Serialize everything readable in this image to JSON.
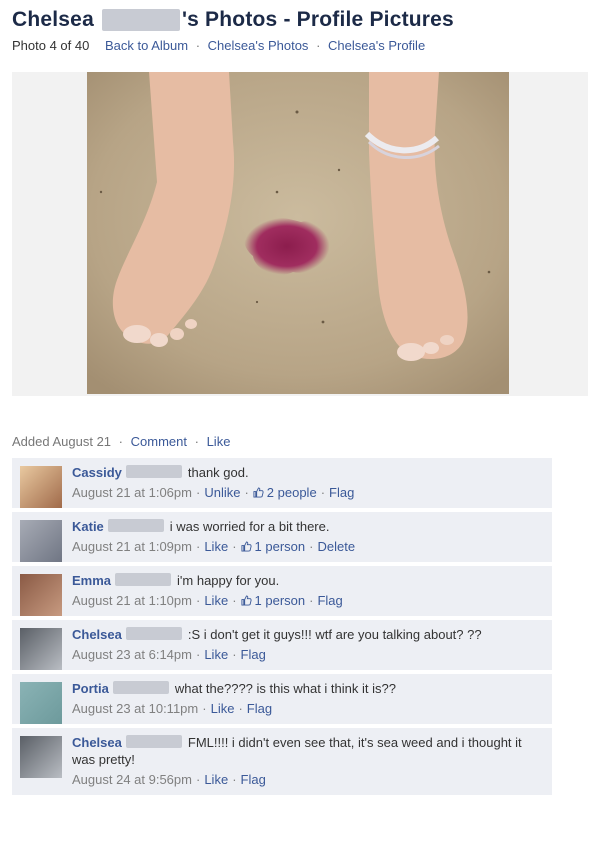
{
  "header": {
    "title_name": "Chelsea",
    "title_rest": "'s Photos - Profile Pictures",
    "photo_count": "Photo 4 of 40",
    "links": [
      "Back to Album",
      "Chelsea's Photos",
      "Chelsea's Profile"
    ],
    "separator": "·"
  },
  "photo_meta": {
    "added": "Added August 21",
    "comment_link": "Comment",
    "like_link": "Like"
  },
  "comments": [
    {
      "author": "Cassidy",
      "text": "thank god.",
      "time": "August 21 at 1:06pm",
      "actions": [
        "Unlike"
      ],
      "likes": "2 people",
      "trail": "Flag",
      "avatar_colors": [
        "#e9c9a0",
        "#a06a4a"
      ]
    },
    {
      "author": "Katie",
      "text": "i was worried for a bit there.",
      "time": "August 21 at 1:09pm",
      "actions": [
        "Like"
      ],
      "likes": "1 person",
      "trail": "Delete",
      "avatar_colors": [
        "#a7abb5",
        "#707684"
      ]
    },
    {
      "author": "Emma",
      "text": "i'm happy for you.",
      "time": "August 21 at 1:10pm",
      "actions": [
        "Like"
      ],
      "likes": "1 person",
      "trail": "Flag",
      "avatar_colors": [
        "#8a5a45",
        "#c79a80"
      ]
    },
    {
      "author": "Chelsea",
      "text": ":S i don't get it guys!!! wtf are you talking about? ??",
      "time": "August 23 at 6:14pm",
      "actions": [
        "Like"
      ],
      "likes": "",
      "trail": "Flag",
      "avatar_colors": [
        "#5a5f66",
        "#b9bdc3"
      ]
    },
    {
      "author": "Portia",
      "text": "what the???? is this what i think it is??",
      "time": "August 23 at 10:11pm",
      "actions": [
        "Like"
      ],
      "likes": "",
      "trail": "Flag",
      "avatar_colors": [
        "#8ab3b5",
        "#6d9a9c"
      ]
    },
    {
      "author": "Chelsea",
      "text": "FML!!!! i didn't even see that, it's sea weed and i thought it was pretty!",
      "time": "August 24 at 9:56pm",
      "actions": [
        "Like"
      ],
      "likes": "",
      "trail": "Flag",
      "avatar_colors": [
        "#5a5f66",
        "#b9bdc3"
      ]
    }
  ],
  "colors": {
    "link": "#3b5998",
    "title": "#1c2a47",
    "comment_bg": "#edeff4",
    "muted": "#808080"
  }
}
